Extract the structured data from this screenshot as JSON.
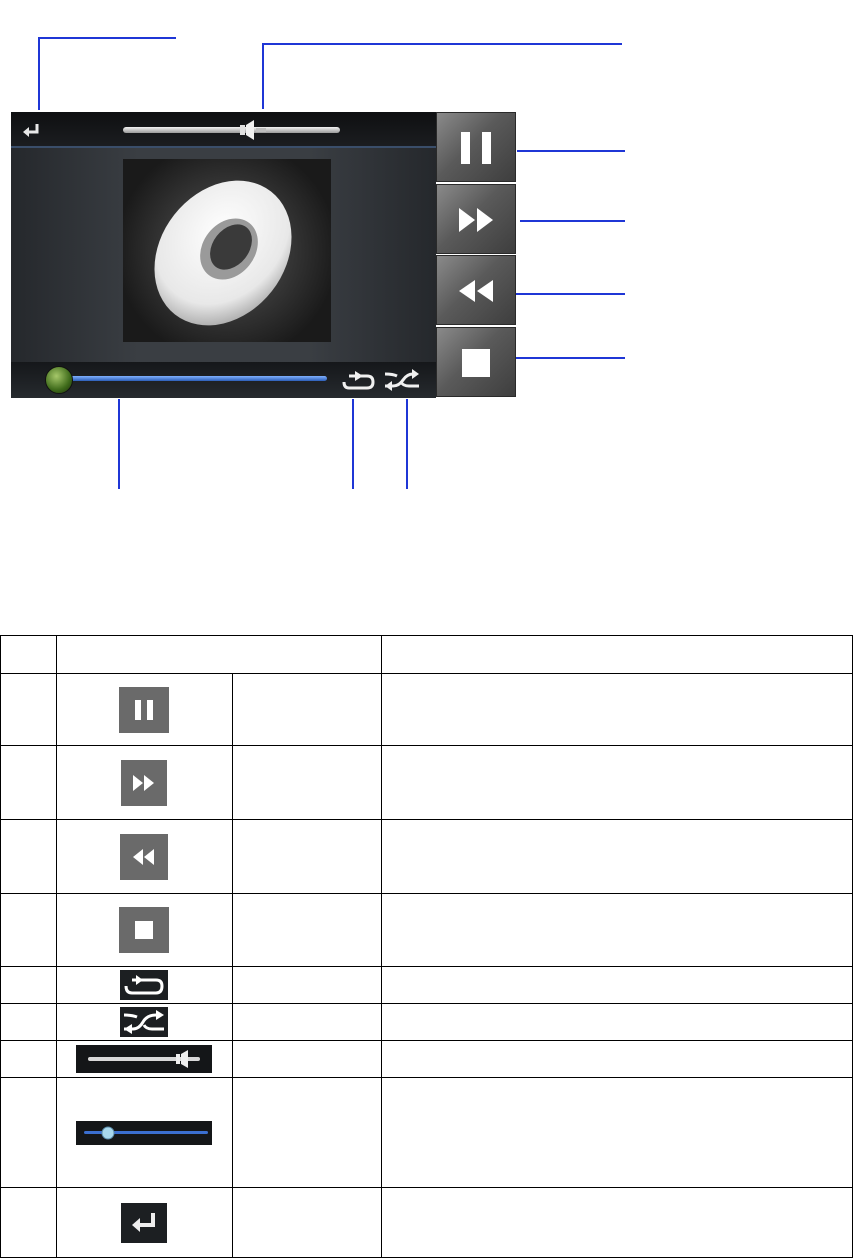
{
  "figure": {
    "player": {
      "controls": {
        "back": "back-arrow-icon",
        "volume": "volume-slider",
        "pause": "pause-icon",
        "fast_forward": "fast-forward-icon",
        "rewind": "rewind-icon",
        "stop": "stop-icon",
        "progress": "progress-slider",
        "repeat": "repeat-icon",
        "shuffle": "shuffle-icon"
      },
      "album_art": "disc-icon"
    },
    "callout_color": "#1f36d6"
  },
  "legend_table": {
    "header": [
      "",
      "",
      ""
    ],
    "rows": [
      {
        "num": "",
        "icon": "pause-icon",
        "name": "",
        "description": ""
      },
      {
        "num": "",
        "icon": "fast-forward-icon",
        "name": "",
        "description": ""
      },
      {
        "num": "",
        "icon": "rewind-icon",
        "name": "",
        "description": ""
      },
      {
        "num": "",
        "icon": "stop-icon",
        "name": "",
        "description": ""
      },
      {
        "num": "",
        "icon": "repeat-icon",
        "name": "",
        "description": ""
      },
      {
        "num": "",
        "icon": "shuffle-icon",
        "name": "",
        "description": ""
      },
      {
        "num": "",
        "icon": "volume-slider",
        "name": "",
        "description": ""
      },
      {
        "num": "",
        "icon": "progress-slider",
        "name": "",
        "description": ""
      },
      {
        "num": "",
        "icon": "back-arrow-icon",
        "name": "",
        "description": ""
      }
    ]
  }
}
